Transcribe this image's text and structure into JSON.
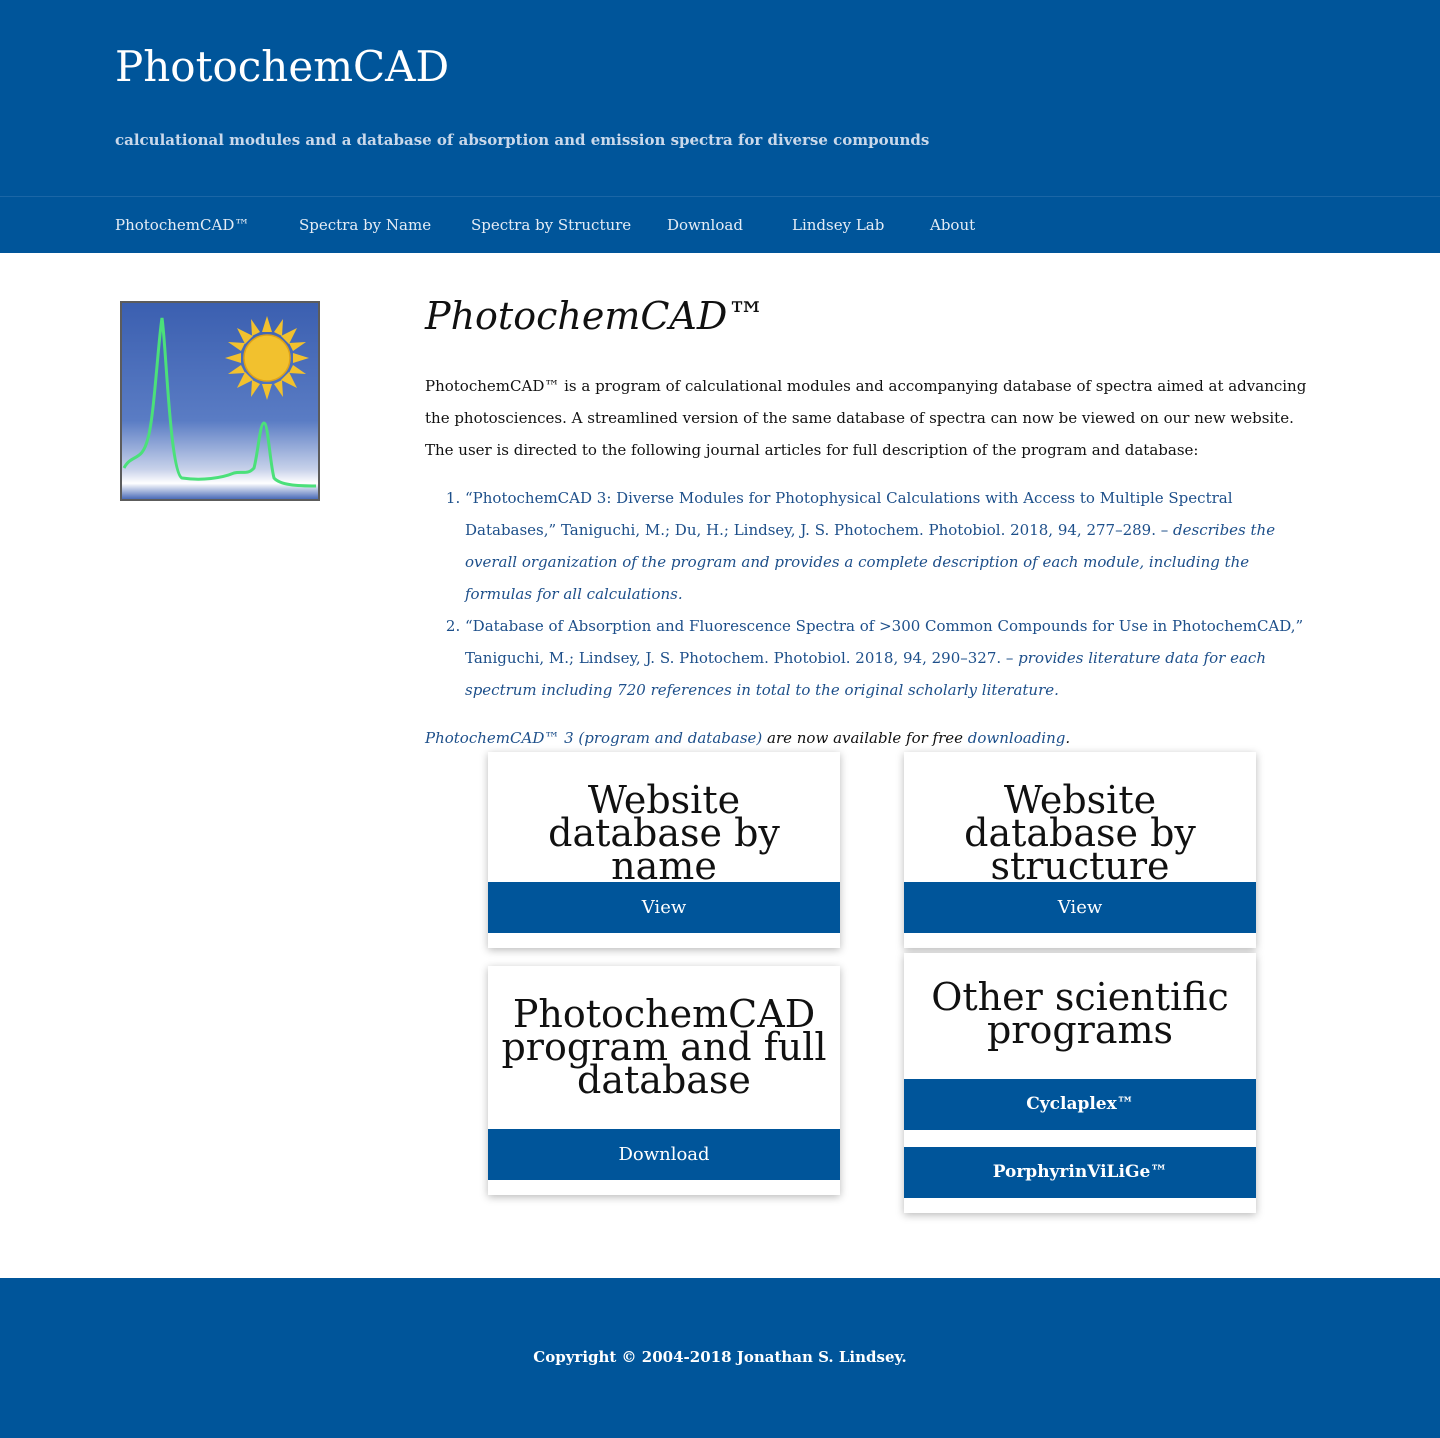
{
  "header": {
    "title": "PhotochemCAD",
    "description": "calculational modules and a database of absorption and emission spectra for diverse compounds"
  },
  "nav": {
    "items": [
      {
        "label": "PhotochemCAD™"
      },
      {
        "label": "Spectra by Name"
      },
      {
        "label": "Spectra by Structure"
      },
      {
        "label": "Download"
      },
      {
        "label": "Lindsey Lab"
      },
      {
        "label": "About"
      }
    ]
  },
  "logo": {
    "icon": "spectrum-sun-logo-icon",
    "colors": {
      "sky": "#3b5fb0",
      "sun": "#f2c12e",
      "trace": "#4be07a"
    }
  },
  "main": {
    "title": "PhotochemCAD™",
    "intro": "PhotochemCAD™ is a program of calculational modules and accompanying database of spectra aimed at advancing the photosciences. A streamlined version of the same database of spectra can now be viewed on our new website. The user is directed to the following journal articles for full description of the program and database:",
    "references": [
      {
        "text": "“PhotochemCAD 3: Diverse Modules for Photophysical Calculations with Access to Multiple Spectral Databases,” Taniguchi, M.; Du, H.; Lindsey, J. S. Photochem. Photobiol. 2018, 94, 277–289. – ",
        "note": "describes the overall organization of the program and provides a complete description of each module, including the formulas for all calculations."
      },
      {
        "text": "“Database of Absorption and Fluorescence Spectra of >300 Common Compounds for Use in PhotochemCAD,” Taniguchi, M.; Lindsey, J. S. Photochem. Photobiol. 2018, 94, 290–327. – ",
        "note": "provides literature data for each spectrum including 720 references in total to the original scholarly literature."
      }
    ],
    "availability": {
      "link1": "PhotochemCAD™ 3 (program and database)",
      "middle": " are now available for free ",
      "link2": "downloading",
      "end": "."
    }
  },
  "cards": {
    "by_name": {
      "title": "Website database by name",
      "button": "View"
    },
    "by_structure": {
      "title": "Website database by structure",
      "button": "View"
    },
    "program": {
      "title": "PhotochemCAD program and full database",
      "button": "Download"
    },
    "other": {
      "title": "Other scientific programs",
      "button1": "Cyclaplex™",
      "button2": "PorphyrinViLiGe™"
    }
  },
  "footer": {
    "copyright": "Copyright © 2004-2018 Jonathan S. Lindsey."
  },
  "colors": {
    "brand_blue": "#00559a",
    "link_blue": "#1d4f8a"
  }
}
